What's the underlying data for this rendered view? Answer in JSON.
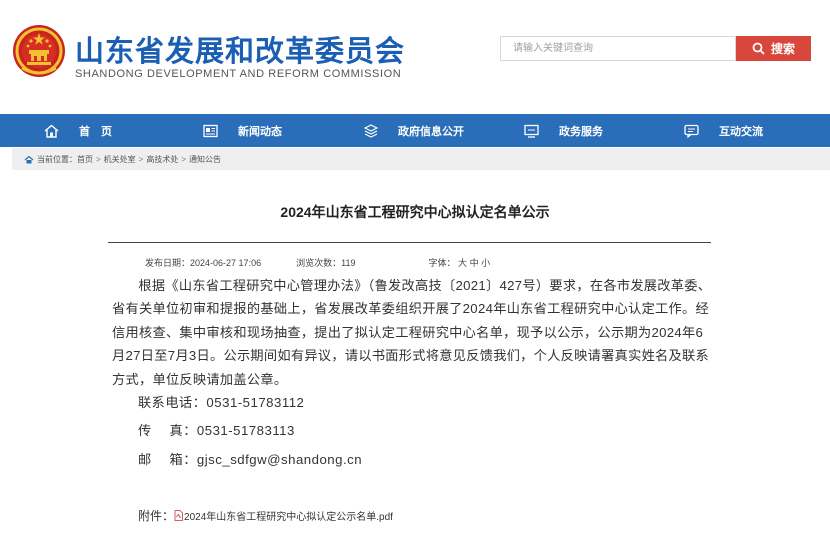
{
  "header": {
    "site_title": "山东省发展和改革委员会",
    "site_subtitle": "SHANDONG DEVELOPMENT AND REFORM COMMISSION",
    "search_placeholder": "请输入关键词查询",
    "search_button": "搜索"
  },
  "nav": {
    "items": [
      {
        "label": "首　页",
        "icon": "home-icon"
      },
      {
        "label": "新闻动态",
        "icon": "news-icon"
      },
      {
        "label": "政府信息公开",
        "icon": "layers-icon"
      },
      {
        "label": "政务服务",
        "icon": "monitor-icon"
      },
      {
        "label": "互动交流",
        "icon": "chat-icon"
      }
    ]
  },
  "breadcrumb": {
    "prefix": "当前位置：",
    "items": [
      "首页",
      "机关处室",
      "高技术处",
      "通知公告"
    ],
    "separator": ">"
  },
  "article": {
    "title": "2024年山东省工程研究中心拟认定名单公示",
    "meta": {
      "publish_label": "发布日期：",
      "publish_date": "2024-06-27 17:06",
      "views_label": "浏览次数：",
      "views": "119",
      "font_label": "字体：",
      "font_large": "大",
      "font_medium": "中",
      "font_small": "小"
    },
    "paragraph": "根据《山东省工程研究中心管理办法》（鲁发改高技〔2021〕427号）要求，在各市发展改革委、省有关单位初审和提报的基础上，省发展改革委组织开展了2024年山东省工程研究中心认定工作。经信用核查、集中审核和现场抽查，提出了拟认定工程研究中心名单，现予以公示，公示期为2024年6月27日至7月3日。公示期间如有异议，请以书面形式将意见反馈我们，个人反映请署真实姓名及联系方式，单位反映请加盖公章。",
    "contact_phone": "联系电话：0531-51783112",
    "contact_fax": "传　 真：0531-51783113",
    "contact_email": "邮　 箱：gjsc_sdfgw@shandong.cn",
    "attachment_label": "附件：",
    "attachment_file": "2024年山东省工程研究中心拟认定公示名单.pdf"
  },
  "colors": {
    "brand_blue": "#1a5fb4",
    "nav_blue": "#2a6db8",
    "search_red": "#d9463b"
  }
}
